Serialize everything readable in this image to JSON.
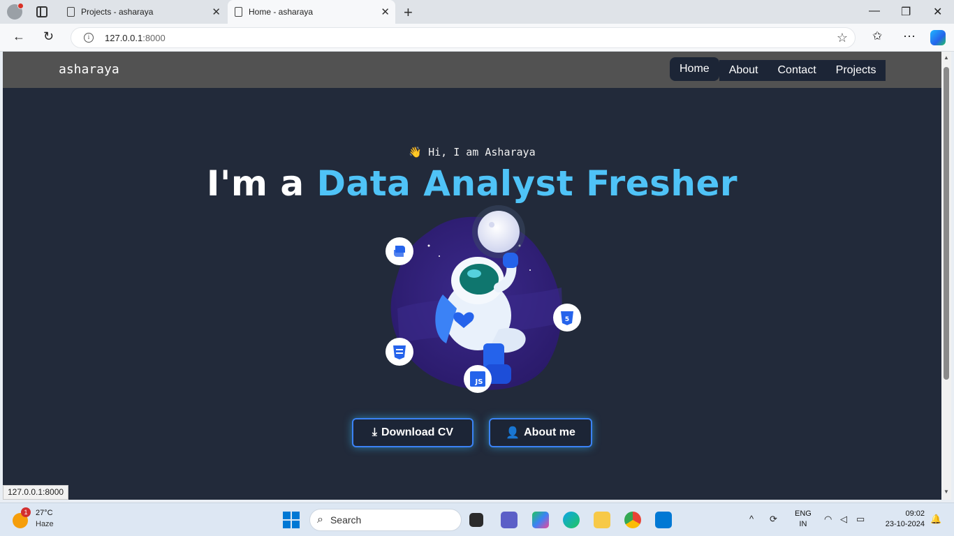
{
  "browser": {
    "tabs": [
      {
        "title": "Projects - asharaya"
      },
      {
        "title": "Home - asharaya"
      }
    ],
    "url_host": "127.0.0.1",
    "url_port": ":8000",
    "status_url": "127.0.0.1:8000"
  },
  "site": {
    "brand": "asharaya",
    "nav": [
      "Home",
      "About",
      "Contact",
      "Projects"
    ],
    "greeting_emoji": "👋",
    "greeting": "Hi, I am Asharaya",
    "headline_prefix": "I'm a ",
    "headline_accent": "Data Analyst Fresher",
    "buttons": {
      "download_cv": "Download CV",
      "about_me": "About me"
    },
    "tech_badges": [
      "python-icon",
      "css3-icon",
      "html5-icon",
      "javascript-icon"
    ],
    "badge_js_text": "JS"
  },
  "taskbar": {
    "weather_alert_count": "1",
    "temperature": "27°C",
    "condition": "Haze",
    "search_placeholder": "Search",
    "lang_top": "ENG",
    "lang_bottom": "IN",
    "time": "09:02",
    "date": "23-10-2024"
  },
  "colors": {
    "page_bg": "#222a3a",
    "header_bg": "#525252",
    "accent": "#4fc3f7",
    "button_glow": "#38bdf8"
  }
}
